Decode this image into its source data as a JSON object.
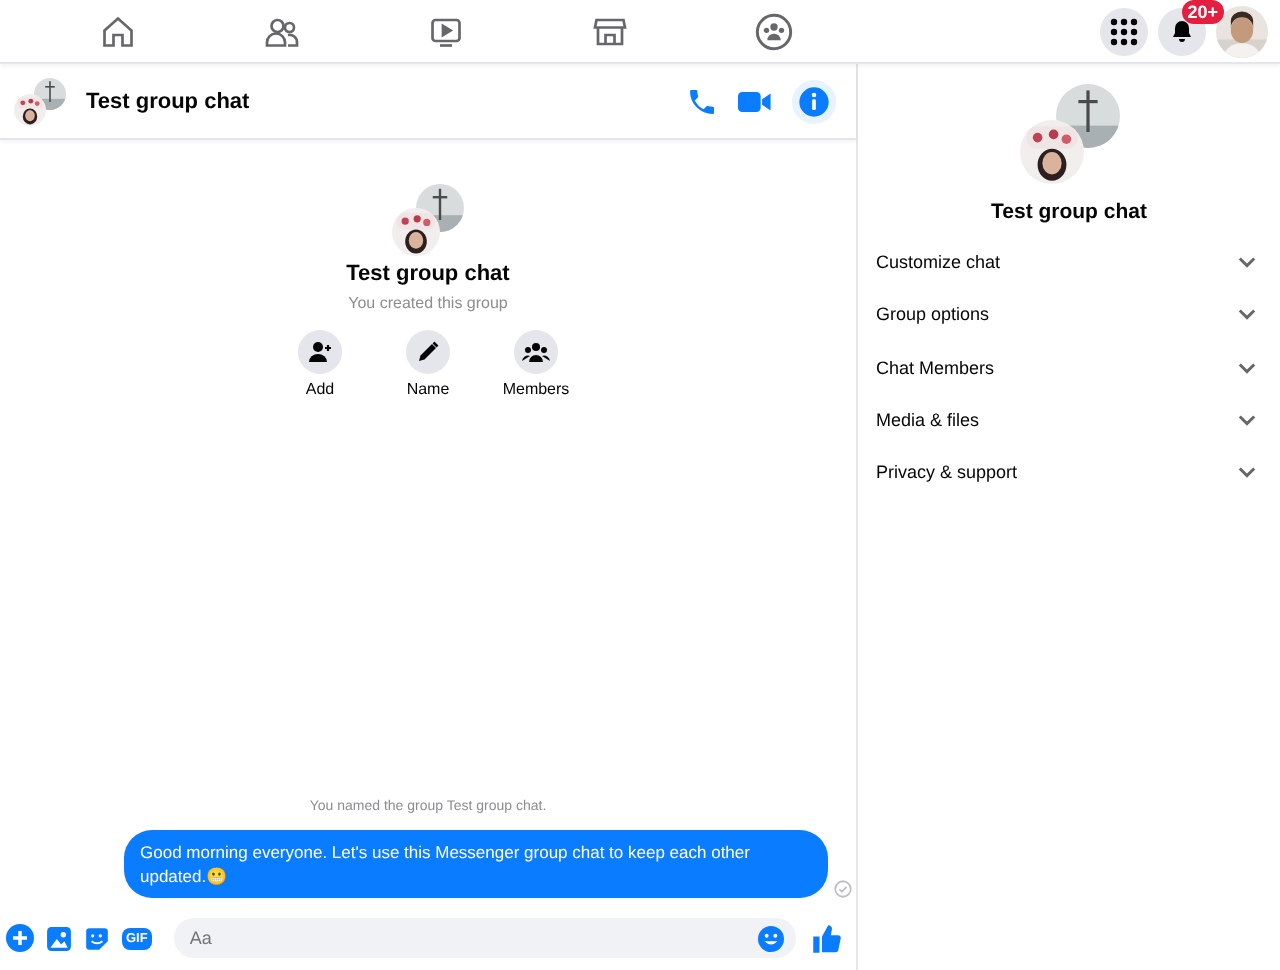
{
  "nav": {
    "tabs": [
      {
        "kind": "home",
        "selected": false
      },
      {
        "kind": "friends",
        "selected": false
      },
      {
        "kind": "video",
        "selected": false
      },
      {
        "kind": "marketplace",
        "selected": false
      },
      {
        "kind": "groups",
        "selected": false
      }
    ],
    "notification_badge": "20+"
  },
  "chat": {
    "title": "Test group chat",
    "intro": {
      "title": "Test group chat",
      "subtitle": "You created this group",
      "actions": [
        {
          "kind": "add",
          "label": "Add"
        },
        {
          "kind": "name",
          "label": "Name"
        },
        {
          "kind": "members",
          "label": "Members"
        }
      ]
    },
    "system_message": "You named the group Test group chat.",
    "messages": [
      {
        "text": "Good morning everyone. Let's use this Messenger group chat to keep each other updated.😬"
      }
    ],
    "composer": {
      "placeholder": "Aa",
      "gif_label": "GIF"
    }
  },
  "details": {
    "title": "Test group chat",
    "sections": [
      {
        "label": "Customize chat",
        "expanded": false
      },
      {
        "label": "Group options",
        "expanded": false
      },
      {
        "label": "Chat Members",
        "expanded": false
      },
      {
        "label": "Media & files",
        "expanded": false
      },
      {
        "label": "Privacy & support",
        "expanded": false
      }
    ]
  }
}
